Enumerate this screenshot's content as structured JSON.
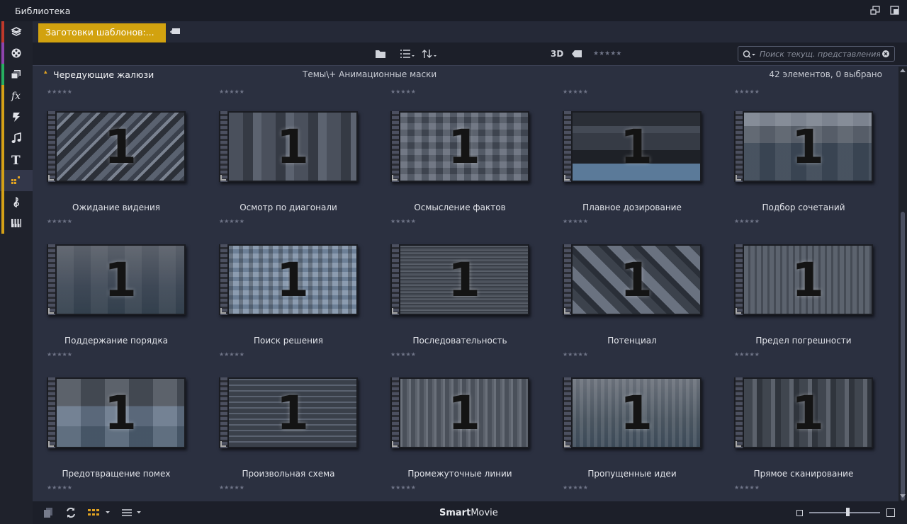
{
  "window": {
    "title": "Библиотека"
  },
  "sidebar": {
    "items": [
      {
        "icon": "package-icon",
        "color": "#c0392b"
      },
      {
        "icon": "film-reel-icon",
        "color": "#8e44ad"
      },
      {
        "icon": "media-stack-icon",
        "color": "#27ae60"
      },
      {
        "icon": "fx-icon",
        "color": "#d4a017"
      },
      {
        "icon": "transition-lightning-icon",
        "color": "#d4a017"
      },
      {
        "icon": "music-note-icon",
        "color": "#d4a017"
      },
      {
        "icon": "text-title-icon",
        "color": "#d4a017"
      },
      {
        "icon": "template-grid-icon",
        "color": "#d4a017",
        "active": true
      },
      {
        "icon": "treble-clef-icon",
        "color": "#d4a017"
      },
      {
        "icon": "piano-keys-icon",
        "color": "#d4a017"
      }
    ]
  },
  "tabs": {
    "active_label": "Заготовки шаблонов:..."
  },
  "toolbar": {
    "label_3d": "3D",
    "search_placeholder": "Поиск текущ. представления"
  },
  "header": {
    "collapse_icon": "▴",
    "title": "Чередующие жалюзи",
    "path": "Темы\\+ Анимационные маски",
    "count": "42 элементов, 0 выбрано"
  },
  "rating_glyphs": "★★★★★",
  "thumb_numeral": "1",
  "items": [
    {
      "label": "Ожидание видения",
      "style": "diagonal"
    },
    {
      "label": "Осмотр по диагонали",
      "style": "columns"
    },
    {
      "label": "Осмысление фактов",
      "style": "mosaic"
    },
    {
      "label": "Плавное дозирование",
      "style": "bands"
    },
    {
      "label": "Подбор сочетаний",
      "style": "blocks"
    },
    {
      "label": "Поддержание порядка",
      "style": "soft"
    },
    {
      "label": "Поиск решения",
      "style": "pixels"
    },
    {
      "label": "Последовательность",
      "style": "lines"
    },
    {
      "label": "Потенциал",
      "style": "diagonal2"
    },
    {
      "label": "Предел погрешности",
      "style": "bars"
    },
    {
      "label": "Предотвращение помех",
      "style": "tiles"
    },
    {
      "label": "Произвольная схема",
      "style": "equalizer"
    },
    {
      "label": "Промежуточные линии",
      "style": "vlines"
    },
    {
      "label": "Пропущенные идеи",
      "style": "fade"
    },
    {
      "label": "Прямое сканирование",
      "style": "vbars"
    }
  ],
  "footer": {
    "brand_bold": "Smart",
    "brand_rest": "Movie",
    "zoom_level": 0.55
  }
}
